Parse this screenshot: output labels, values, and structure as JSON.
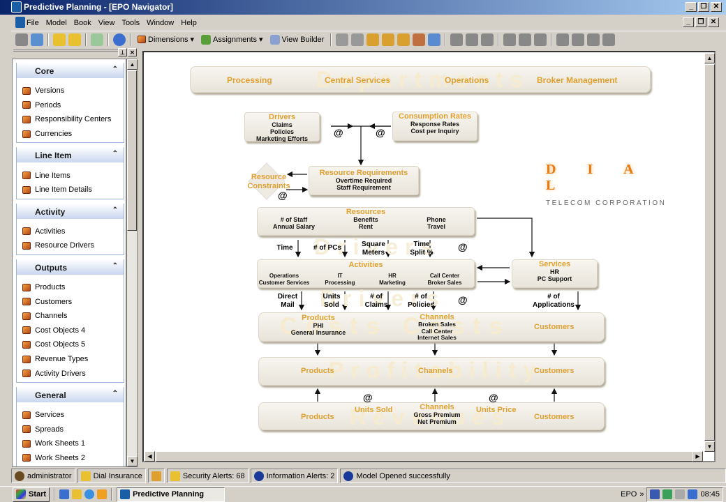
{
  "window": {
    "title": "Predictive Planning - [EPO Navigator]"
  },
  "menu": [
    "File",
    "Model",
    "Book",
    "View",
    "Tools",
    "Window",
    "Help"
  ],
  "toolbar": {
    "dimensions": "Dimensions",
    "assignments": "Assignments",
    "view_builder": "View Builder"
  },
  "sidebar": {
    "sections": [
      {
        "title": "Core",
        "items": [
          "Versions",
          "Periods",
          "Responsibility Centers",
          "Currencies"
        ]
      },
      {
        "title": "Line Item",
        "items": [
          "Line Items",
          "Line Item Details"
        ]
      },
      {
        "title": "Activity",
        "items": [
          "Activities",
          "Resource Drivers"
        ]
      },
      {
        "title": "Outputs",
        "items": [
          "Products",
          "Customers",
          "Channels",
          "Cost Objects 4",
          "Cost Objects 5",
          "Revenue Types",
          "Activity Drivers"
        ]
      },
      {
        "title": "General",
        "items": [
          "Services",
          "Spreads",
          "Work Sheets 1",
          "Work Sheets 2"
        ]
      }
    ]
  },
  "diagram": {
    "watermarks": {
      "departments": "Departments",
      "drivers1": "Drivers",
      "drivers2": "Drivers",
      "costs": "Costs  Costs",
      "profitability": "Profitability",
      "revenues": "Revenues"
    },
    "departments": [
      "Processing",
      "Central Services",
      "Operations",
      "Broker Management"
    ],
    "drivers": {
      "title": "Drivers",
      "lines": [
        "Claims",
        "Policies",
        "Marketing Efforts"
      ]
    },
    "consumption": {
      "title": "Consumption Rates",
      "lines": [
        "Response Rates",
        "Cost per Inquiry"
      ]
    },
    "resource_constraints": "Resource Constraints",
    "resource_requirements": {
      "title": "Resource Requirements",
      "lines": [
        "Overtime Required",
        "Staff Requirement"
      ]
    },
    "logo": {
      "letters": "D I A L",
      "subtitle": "TELECOM CORPORATION"
    },
    "resources": {
      "title": "Resources",
      "cols": [
        "# of Staff\nAnnual Salary",
        "Benefits\nRent",
        "Phone\nTravel"
      ]
    },
    "resource_drivers": [
      "Time",
      "# of PCs",
      "Square Meters",
      "Time Split %"
    ],
    "activities": {
      "title": "Activities",
      "cols": [
        "Operations\nCustomer Services",
        "IT\nProcessing",
        "HR\nMarketing",
        "Call Center\nBroker Sales"
      ]
    },
    "services": {
      "title": "Services",
      "lines": [
        "HR",
        "PC Support"
      ]
    },
    "activity_drivers": [
      "Direct Mail",
      "Units Sold",
      "# of Claims",
      "# of Policies"
    ],
    "service_driver": "# of Applications",
    "costs": {
      "products_title": "Products",
      "products": "PHI\nGeneral Insurance",
      "channels_title": "Channels",
      "channels": "Broken Sales\nCall Center\nInternet Sales",
      "customers": "Customers"
    },
    "profitability": [
      "Products",
      "Channels",
      "Customers"
    ],
    "revenues": {
      "products": "Products",
      "units_sold": "Units Sold",
      "channels_title": "Channels",
      "channels": "Gross Premium\nNet Premium",
      "units_price": "Units Price",
      "customers": "Customers"
    }
  },
  "status": {
    "user": "administrator",
    "model": "Dial Insurance",
    "security": "Security Alerts: 68",
    "info": "Information Alerts: 2",
    "message": "Model Opened successfully"
  },
  "taskbar": {
    "start": "Start",
    "task": "Predictive Planning",
    "tray_label": "EPO",
    "clock": "08:45"
  }
}
